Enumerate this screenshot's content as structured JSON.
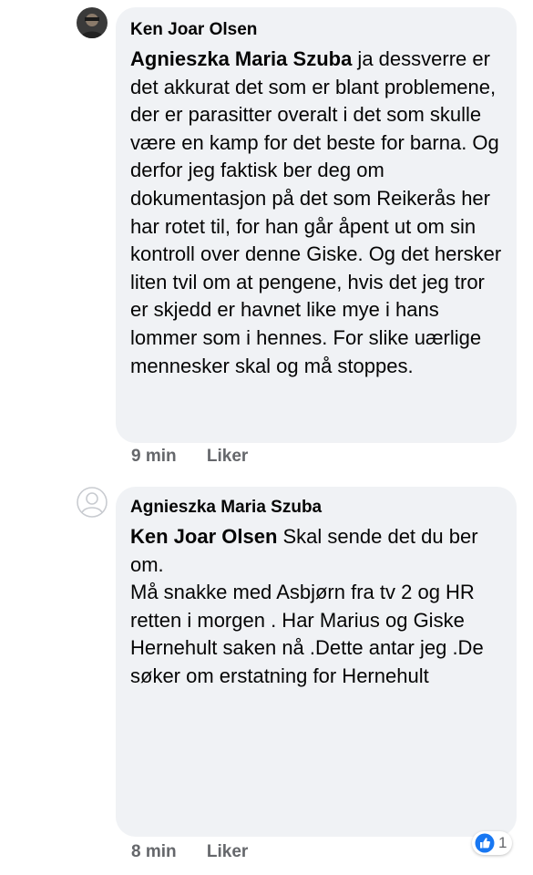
{
  "comments": [
    {
      "author": "Ken Joar Olsen",
      "mention": "Agnieszka Maria Szuba",
      "text": " ja dessverre er det akkurat det som er blant problemene, der er parasitter overalt i det som skulle være en kamp for det beste for barna. Og derfor jeg faktisk ber deg om dokumentasjon på det som Reikerås her har rotet til, for han går åpent ut om sin kontroll over denne Giske. Og det hersker liten tvil om at pengene, hvis det jeg tror er skjedd er havnet like mye i hans lommer som i hennes. For slike uærlige mennesker skal og må stoppes.",
      "time": "9 min",
      "like_label": "Liker"
    },
    {
      "author": "Agnieszka Maria Szuba",
      "mention": "Ken Joar Olsen",
      "text": " Skal sende det du ber om.\nMå snakke med Asbjørn fra  tv  2 og HR retten i morgen . Har Marius og Giske Hernehult saken nå .Dette antar jeg .De søker om erstatning for Hernehult",
      "time": "8 min",
      "like_label": "Liker",
      "reaction_count": "1",
      "reaction_icon": "like-icon"
    }
  ],
  "colors": {
    "bubble": "#f0f2f5",
    "meta": "#65676b",
    "like_blue": "#1877f2"
  }
}
